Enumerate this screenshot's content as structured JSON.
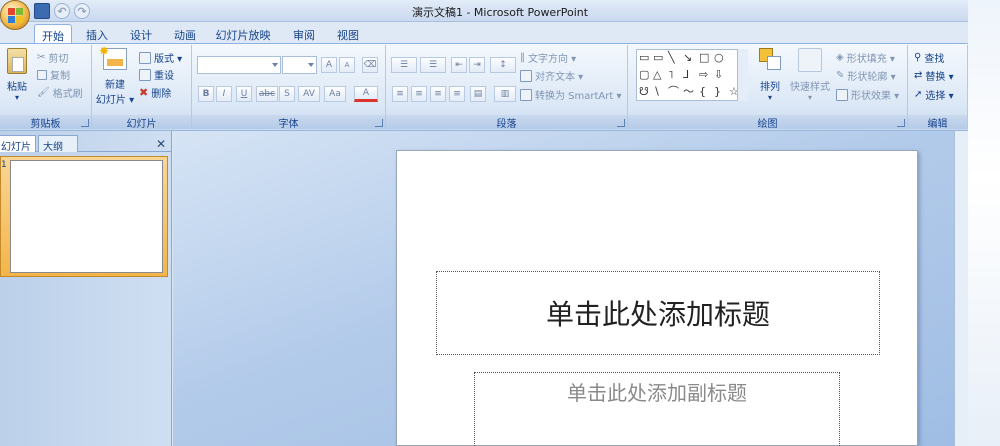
{
  "window": {
    "title": "演示文稿1 - Microsoft PowerPoint"
  },
  "tabs": [
    {
      "label": "开始",
      "active": true
    },
    {
      "label": "插入"
    },
    {
      "label": "设计"
    },
    {
      "label": "动画"
    },
    {
      "label": "幻灯片放映"
    },
    {
      "label": "审阅"
    },
    {
      "label": "视图"
    }
  ],
  "ribbon": {
    "clipboard": {
      "label": "剪贴板",
      "paste": "粘贴",
      "cut": "剪切",
      "copy": "复制",
      "format_painter": "格式刷"
    },
    "slides": {
      "label": "幻灯片",
      "new_slide_1": "新建",
      "new_slide_2": "幻灯片 ▾",
      "layout": "版式 ▾",
      "reset": "重设",
      "delete": "删除"
    },
    "font": {
      "label": "字体",
      "bold": "B",
      "italic": "I",
      "underline": "U",
      "strike": "abc",
      "shadow": "S",
      "spacing": "AV",
      "case": "Aa",
      "color": "A",
      "grow": "A",
      "shrink": "A"
    },
    "paragraph": {
      "label": "段落",
      "text_direction": "文字方向 ▾",
      "align_text": "对齐文本 ▾",
      "smartart": "转换为 SmartArt ▾"
    },
    "drawing": {
      "label": "绘图",
      "arrange": "排列",
      "quick_styles": "快速样式",
      "shape_fill": "形状填充 ▾",
      "shape_outline": "形状轮廓 ▾",
      "shape_effects": "形状效果 ▾"
    },
    "editing": {
      "label": "编辑",
      "find": "查找",
      "replace": "替换 ▾",
      "select": "选择 ▾"
    }
  },
  "left_pane": {
    "tab_slides": "幻灯片",
    "tab_outline": "大纲",
    "close": "✕",
    "slide_number": "1"
  },
  "slide": {
    "title_placeholder": "单击此处添加标题",
    "subtitle_placeholder": "单击此处添加副标题"
  },
  "colors": {
    "accent": "#15428b",
    "ribbon_border": "#8db2e3"
  }
}
